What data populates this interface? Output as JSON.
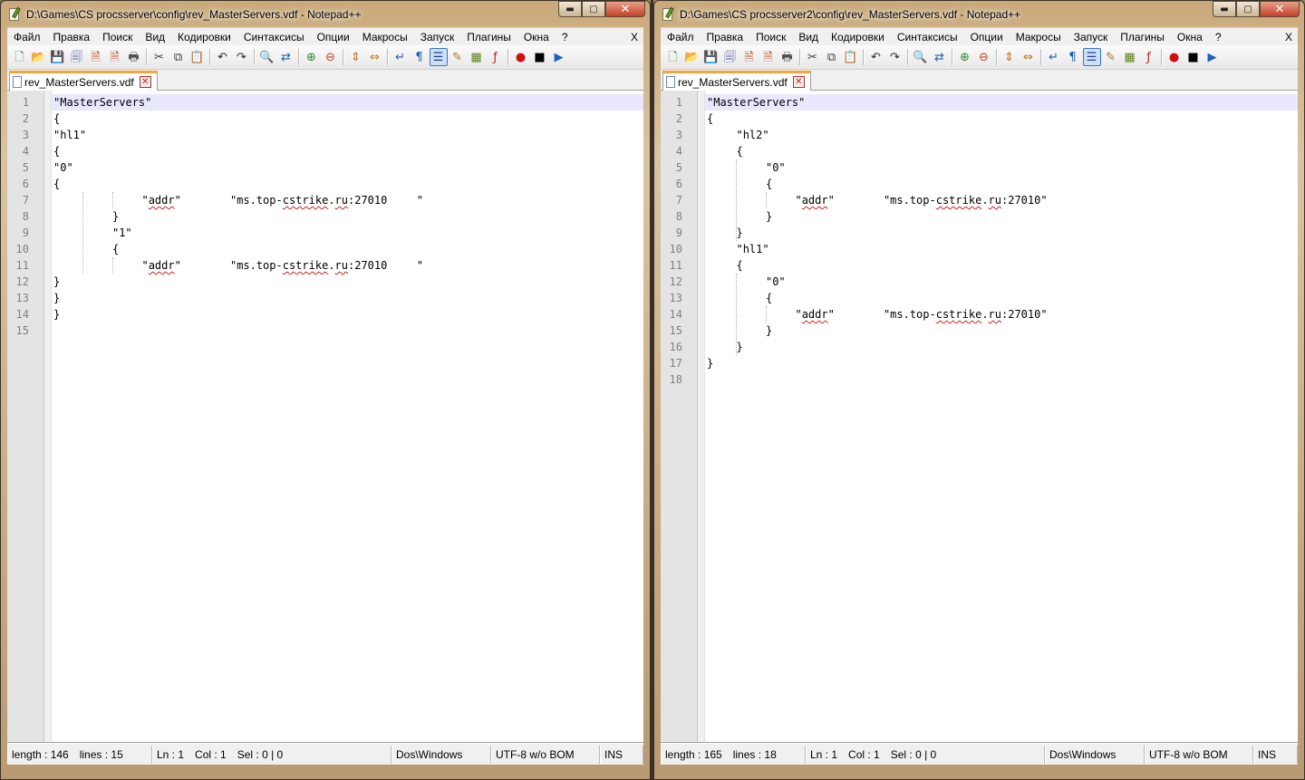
{
  "windows": [
    {
      "id": "left",
      "title": "D:\\Games\\CS procsserver\\config\\rev_MasterServers.vdf - Notepad++",
      "menu": [
        "Файл",
        "Правка",
        "Поиск",
        "Вид",
        "Кодировки",
        "Синтаксисы",
        "Опции",
        "Макросы",
        "Запуск",
        "Плагины",
        "Окна",
        "?"
      ],
      "menu_close": "X",
      "tab_label": "rev_MasterServers.vdf",
      "lines": [
        [
          "\"MasterServers\""
        ],
        [
          "{"
        ],
        [
          "\"hl1\""
        ],
        [
          "{"
        ],
        [
          "\"0\""
        ],
        [
          "{"
        ],
        [
          "\"addr\"",
          "\"ms.top-cstrike.ru:27010",
          "\""
        ],
        [
          "}"
        ],
        [
          "\"1\""
        ],
        [
          "{"
        ],
        [
          "\"addr\"",
          "\"ms.top-cstrike.ru:27010",
          "\""
        ],
        [
          "}"
        ],
        [
          "}"
        ],
        [
          "}"
        ],
        []
      ],
      "status": {
        "length": "length : 146",
        "lines": "lines : 15",
        "ln": "Ln : 1",
        "col": "Col : 1",
        "sel": "Sel : 0 | 0",
        "eol": "Dos\\Windows",
        "encoding": "UTF-8 w/o BOM",
        "mode": "INS"
      }
    },
    {
      "id": "right",
      "title": "D:\\Games\\CS procsserver2\\config\\rev_MasterServers.vdf - Notepad++",
      "menu": [
        "Файл",
        "Правка",
        "Поиск",
        "Вид",
        "Кодировки",
        "Синтаксисы",
        "Опции",
        "Макросы",
        "Запуск",
        "Плагины",
        "Окна",
        "?"
      ],
      "menu_close": "X",
      "tab_label": "rev_MasterServers.vdf",
      "lines": [
        [
          "\"MasterServers\""
        ],
        [
          "{"
        ],
        [
          "\"hl2\""
        ],
        [
          "{"
        ],
        [
          "\"0\""
        ],
        [
          "{"
        ],
        [
          "\"addr\"",
          "\"ms.top-cstrike.ru:27010\""
        ],
        [
          "}"
        ],
        [
          "}"
        ],
        [
          "\"hl1\""
        ],
        [
          "{"
        ],
        [
          "\"0\""
        ],
        [
          "{"
        ],
        [
          "\"addr\"",
          "\"ms.top-cstrike.ru:27010\""
        ],
        [
          "}"
        ],
        [
          "}"
        ],
        [
          "}"
        ],
        []
      ],
      "status": {
        "length": "length : 165",
        "lines": "lines : 18",
        "ln": "Ln : 1",
        "col": "Col : 1",
        "sel": "Sel : 0 | 0",
        "eol": "Dos\\Windows",
        "encoding": "UTF-8 w/o BOM",
        "mode": "INS"
      }
    }
  ],
  "caption_buttons": {
    "minimize": "▬",
    "maximize": "▢",
    "close": "✕"
  },
  "toolbar_icons": [
    "new-file-icon",
    "open-file-icon",
    "save-icon",
    "save-all-icon",
    "close-file-icon",
    "close-all-icon",
    "print-icon",
    "|",
    "cut-icon",
    "copy-icon",
    "paste-icon",
    "|",
    "undo-icon",
    "redo-icon",
    "|",
    "find-icon",
    "replace-icon",
    "|",
    "zoom-in-icon",
    "zoom-out-icon",
    "|",
    "sync-vertical-icon",
    "sync-horizontal-icon",
    "|",
    "word-wrap-icon",
    "show-all-chars-icon",
    "indent-guide-icon",
    "user-language-icon",
    "doc-map-icon",
    "function-list-icon",
    "|",
    "record-macro-icon",
    "stop-macro-icon",
    "play-macro-icon"
  ],
  "colors": {
    "caret_line": "#e8e8ff",
    "tab_accent": "#f7a437",
    "gutter": "#e4e4e4",
    "line_number": "#808080",
    "spell_error": "#d02020"
  }
}
